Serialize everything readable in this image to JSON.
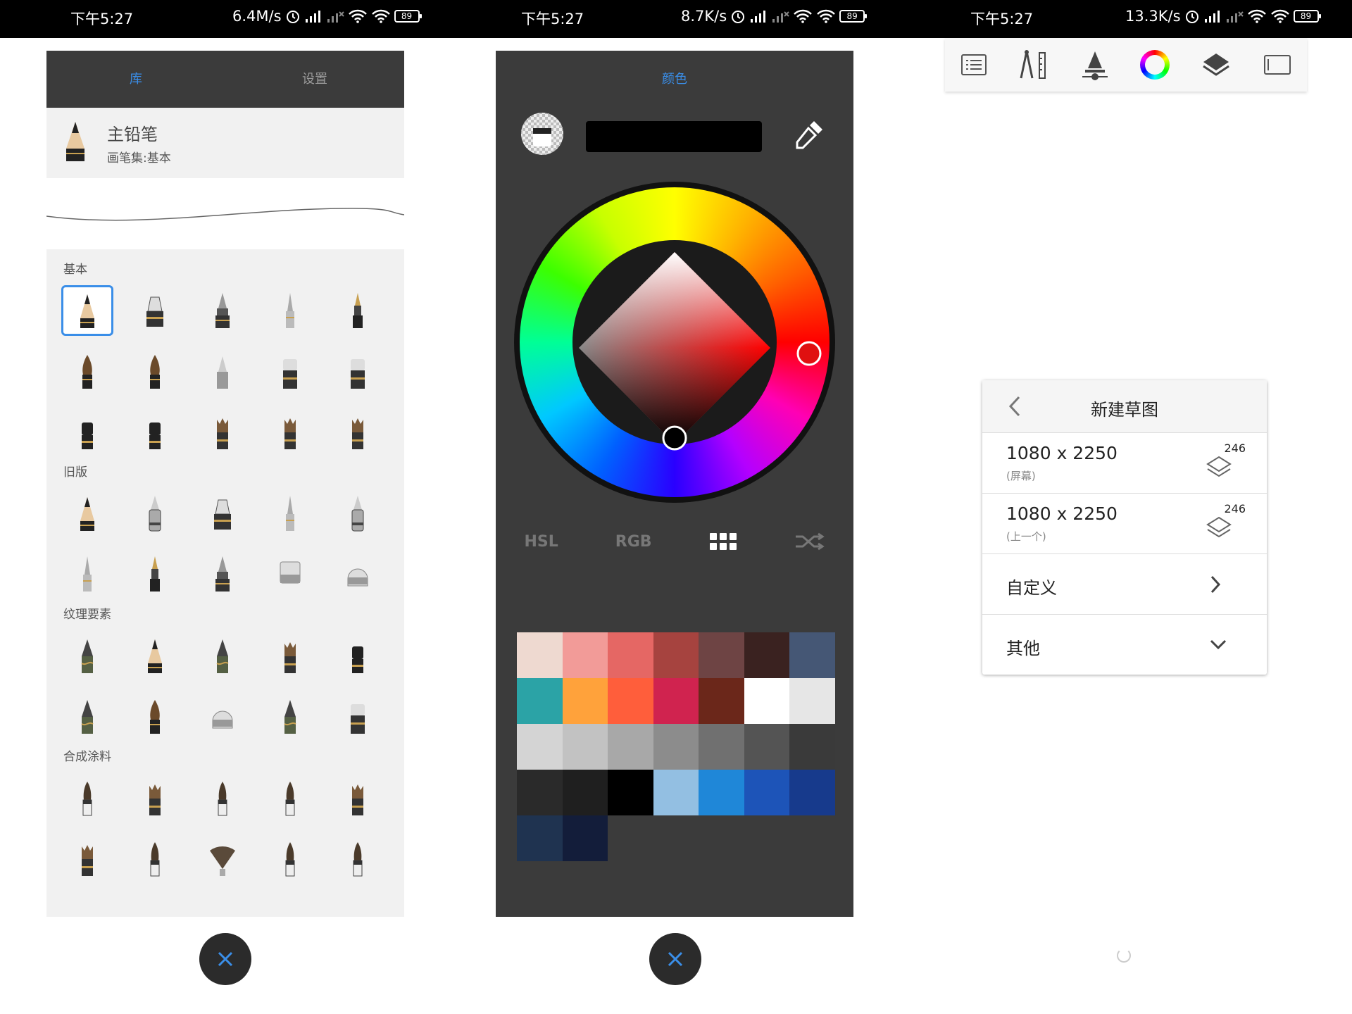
{
  "status_bars": [
    {
      "time": "下午5:27",
      "speed": "6.4M/s",
      "battery": "89"
    },
    {
      "time": "下午5:27",
      "speed": "8.7K/s",
      "battery": "89"
    },
    {
      "time": "下午5:27",
      "speed": "13.3K/s",
      "battery": "89"
    }
  ],
  "brush_library": {
    "tabs": [
      "库",
      "设置"
    ],
    "current_brush": {
      "name": "主铅笔",
      "set": "画笔集:基本"
    },
    "sections": [
      "基本",
      "旧版",
      "纹理要素",
      "合成涂料"
    ]
  },
  "color_panel": {
    "title": "颜色",
    "modes": [
      "HSL",
      "RGB"
    ],
    "current_color": "#000000",
    "palette": [
      "#eed9d0",
      "#f29b98",
      "#e56764",
      "#a6433f",
      "#6e4444",
      "#3a2220",
      "#455775",
      "#2ba3a6",
      "#ffa23b",
      "#ff5e3b",
      "#d0234f",
      "#6b271a",
      "#ffffff",
      "#e6e6e6",
      "#d4d4d4",
      "#c2c2c2",
      "#a8a8a8",
      "#8c8c8c",
      "#707070",
      "#545454",
      "#3a3a3a",
      "#2a2a2a",
      "#1f1f1f",
      "#000000",
      "#93bfe2",
      "#1f87d8",
      "#1d54b8",
      "#173a8c",
      "#1f3350",
      "#131d3a"
    ]
  },
  "new_sketch": {
    "title": "新建草图",
    "options": [
      {
        "size": "1080 x 2250",
        "sub": "(屏幕)",
        "count": "246"
      },
      {
        "size": "1080 x 2250",
        "sub": "(上一个)",
        "count": "246"
      }
    ],
    "custom_label": "自定义",
    "other_label": "其他"
  }
}
